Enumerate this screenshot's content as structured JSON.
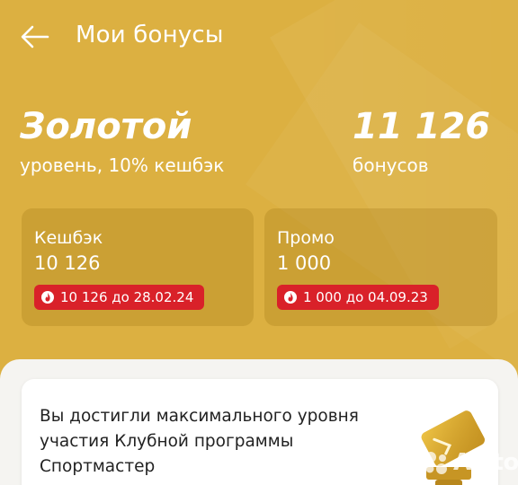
{
  "header": {
    "title": "Мои бонусы",
    "back_icon": "arrow-left-icon"
  },
  "level": {
    "name": "Золотой",
    "description": "уровень, 10% кешбэк"
  },
  "bonuses": {
    "total": "11 126",
    "label": "бонусов"
  },
  "cards": [
    {
      "label": "Кешбэк",
      "value": "10 126",
      "expire": "10 126 до 28.02.24"
    },
    {
      "label": "Промо",
      "value": "1 000",
      "expire": "1 000 до 04.09.23"
    }
  ],
  "info": {
    "text": "Вы достигли максимального уровня участия Клубной программы Спортмастер"
  },
  "watermark": "Avito",
  "colors": {
    "background": "#dcb041",
    "expire_badge": "#d92129",
    "panel": "#f5f4f1"
  }
}
